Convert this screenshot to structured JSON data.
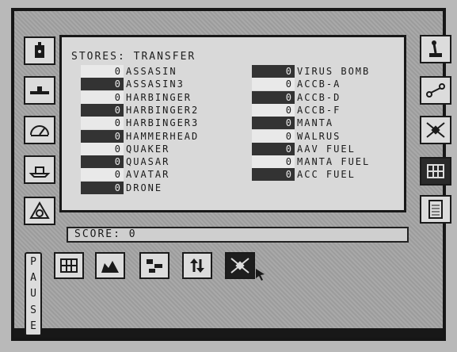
{
  "stores": {
    "title": "STORES: TRANSFER",
    "left_items": [
      {
        "qty": "0",
        "name": "ASSASIN"
      },
      {
        "qty": "0",
        "name": "ASSASIN3"
      },
      {
        "qty": "0",
        "name": "HARBINGER"
      },
      {
        "qty": "0",
        "name": "HARBINGER2"
      },
      {
        "qty": "0",
        "name": "HARBINGER3"
      },
      {
        "qty": "0",
        "name": "HAMMERHEAD"
      },
      {
        "qty": "0",
        "name": "QUAKER"
      },
      {
        "qty": "0",
        "name": "QUASAR"
      },
      {
        "qty": "0",
        "name": "AVATAR"
      },
      {
        "qty": "0",
        "name": "DRONE"
      }
    ],
    "right_items": [
      {
        "qty": "0",
        "name": "VIRUS BOMB"
      },
      {
        "qty": "0",
        "name": "ACCB-A"
      },
      {
        "qty": "0",
        "name": "ACCB-D"
      },
      {
        "qty": "0",
        "name": "ACCB-F"
      },
      {
        "qty": "0",
        "name": "MANTA"
      },
      {
        "qty": "0",
        "name": "WALRUS"
      },
      {
        "qty": "0",
        "name": "AAV FUEL"
      },
      {
        "qty": "0",
        "name": "MANTA FUEL"
      },
      {
        "qty": "0",
        "name": "ACC FUEL"
      }
    ]
  },
  "score": {
    "text": "SCORE: 0"
  },
  "pause": {
    "letters": [
      "P",
      "A",
      "U",
      "S",
      "E"
    ]
  },
  "left_icons": [
    "bomb-icon",
    "submarine-icon",
    "gauge-icon",
    "ship-icon",
    "radar-dome-icon"
  ],
  "right_icons": [
    "joystick-icon",
    "transfer-icon",
    "satellite-icon",
    "grid-icon",
    "document-icon"
  ],
  "bottom_icons": [
    "grid-icon",
    "landscape-icon",
    "map-icon",
    "up-down-arrows-icon",
    "satellite-icon"
  ]
}
